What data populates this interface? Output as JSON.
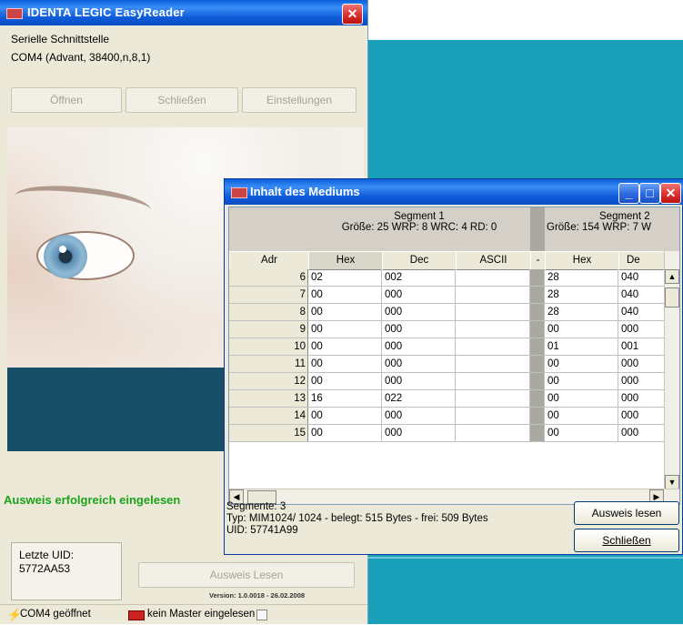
{
  "main_window": {
    "title": "IDENTA LEGIC EasyReader",
    "group_label": "Serielle Schnittstelle",
    "port": "COM4 (Advant, 38400,n,8,1)",
    "buttons": {
      "open": "Öffnen",
      "close": "Schließen",
      "settings": "Einstellungen"
    },
    "status_message": "Ausweis erfolgreich eingelesen",
    "last_uid_label": "Letzte UID:",
    "last_uid_value": "5772AA53",
    "read_button": "Ausweis Lesen",
    "version": "Version: 1.0.0018 - 26.02.2008",
    "statusbar": {
      "port_status": "COM4 geöffnet",
      "master_status": "kein Master eingelesen"
    },
    "status_color": "#1aa31a"
  },
  "medium_window": {
    "title": "Inhalt des Mediums",
    "segments": [
      {
        "title": "Segment 1",
        "info": "Größe: 25 WRP: 8 WRC: 4 RD: 0"
      },
      {
        "title": "Segment 2",
        "info": "Größe: 154 WRP: 7 W"
      }
    ],
    "columns": {
      "adr": "Adr",
      "seg1": [
        "Hex",
        "Dec",
        "ASCII"
      ],
      "seg2": [
        "Hex",
        "De"
      ]
    },
    "rows": [
      {
        "adr": "6",
        "hex1": "02",
        "dec1": "002",
        "ascii1": "",
        "hex2": "28",
        "dec2": "040"
      },
      {
        "adr": "7",
        "hex1": "00",
        "dec1": "000",
        "ascii1": "",
        "hex2": "28",
        "dec2": "040"
      },
      {
        "adr": "8",
        "hex1": "00",
        "dec1": "000",
        "ascii1": "",
        "hex2": "28",
        "dec2": "040"
      },
      {
        "adr": "9",
        "hex1": "00",
        "dec1": "000",
        "ascii1": "",
        "hex2": "00",
        "dec2": "000"
      },
      {
        "adr": "10",
        "hex1": "00",
        "dec1": "000",
        "ascii1": "",
        "hex2": "01",
        "dec2": "001"
      },
      {
        "adr": "11",
        "hex1": "00",
        "dec1": "000",
        "ascii1": "",
        "hex2": "00",
        "dec2": "000"
      },
      {
        "adr": "12",
        "hex1": "00",
        "dec1": "000",
        "ascii1": "",
        "hex2": "00",
        "dec2": "000"
      },
      {
        "adr": "13",
        "hex1": "16",
        "dec1": "022",
        "ascii1": "",
        "hex2": "00",
        "dec2": "000"
      },
      {
        "adr": "14",
        "hex1": "00",
        "dec1": "000",
        "ascii1": "",
        "hex2": "00",
        "dec2": "000"
      },
      {
        "adr": "15",
        "hex1": "00",
        "dec1": "000",
        "ascii1": "",
        "hex2": "00",
        "dec2": "000"
      }
    ],
    "info": {
      "segments": "Segmente: 3",
      "type": "Typ: MIM1024/ 1024 - belegt: 515 Bytes - frei: 509 Bytes",
      "uid": "UID: 57741A99"
    },
    "buttons": {
      "read": "Ausweis lesen",
      "close": "Schließen"
    }
  },
  "colors": {
    "titlebar": "#0a5fdc",
    "background_teal": "#17a0b7",
    "window_face": "#ece9d8"
  }
}
